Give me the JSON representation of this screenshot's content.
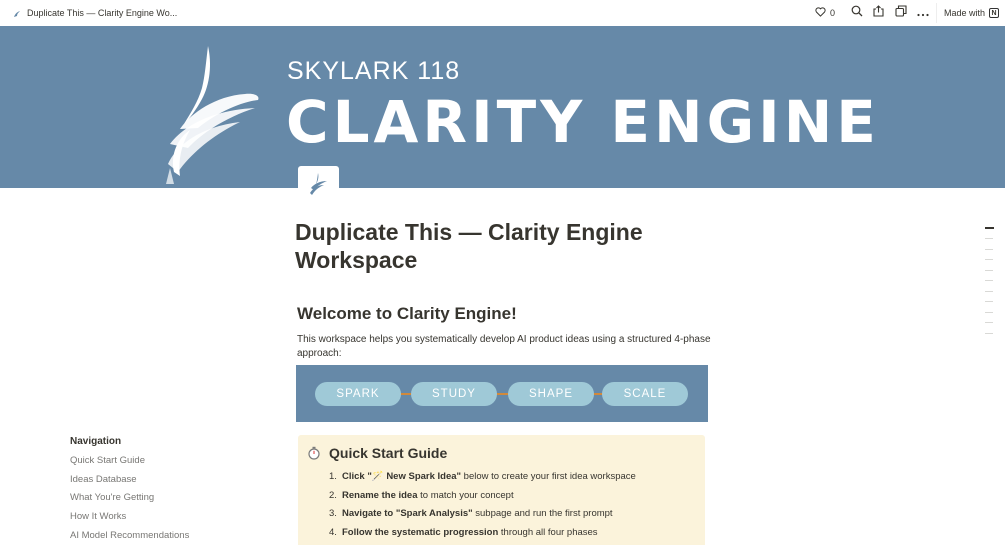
{
  "topbar": {
    "title": "Duplicate This — Clarity Engine Wo...",
    "likes": "0",
    "made_with": "Made with",
    "icons": [
      "heart-icon",
      "search-icon",
      "share-icon",
      "duplicate-icon",
      "more-icon",
      "notion-logo-icon"
    ]
  },
  "banner": {
    "subtitle": "SKYLARK 118",
    "title": "CLARITY ENGINE",
    "color": "#6689a8"
  },
  "page": {
    "title": "Duplicate This — Clarity Engine Workspace",
    "heading": "Welcome to Clarity Engine!",
    "intro": "This workspace helps you systematically develop AI product ideas using a structured 4-phase approach:"
  },
  "phases": {
    "items": [
      "SPARK",
      "STUDY",
      "SHAPE",
      "SCALE"
    ],
    "pill_color": "#9fc9d7",
    "line_color": "#d2893a"
  },
  "callout": {
    "icon": "stopwatch-icon",
    "title": "Quick Start Guide",
    "background": "#fbf3db",
    "steps": [
      {
        "num": "1.",
        "bold": "Click \"🪄 New Spark Idea\"",
        "rest": " below to create your first idea workspace"
      },
      {
        "num": "2.",
        "bold": "Rename the idea",
        "rest": " to match your concept"
      },
      {
        "num": "3.",
        "bold": "Navigate to \"Spark Analysis\"",
        "rest": " subpage and run the first prompt"
      },
      {
        "num": "4.",
        "bold": "Follow the systematic progression",
        "rest": " through all four phases"
      }
    ]
  },
  "navigation": {
    "heading": "Navigation",
    "items": [
      "Quick Start Guide",
      "Ideas Database",
      "What You're Getting",
      "How It Works",
      "AI Model Recommendations"
    ]
  }
}
